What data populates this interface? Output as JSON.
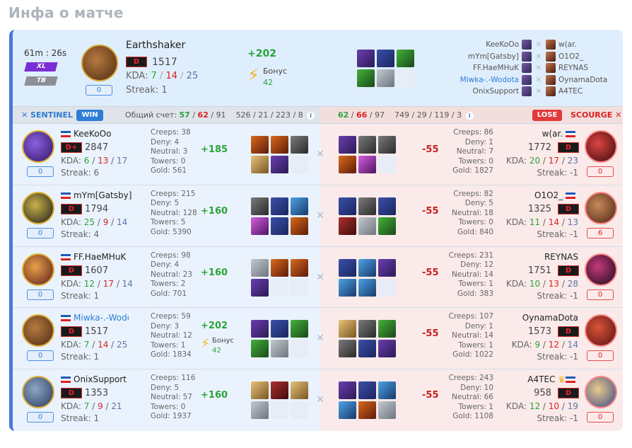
{
  "page_title": "Инфа о матче",
  "summary": {
    "duration": "61m : 26s",
    "mode_badge": "XL",
    "type_badge": "TB",
    "hero_name": "Earthshaker",
    "rank": "D",
    "mmr": "1517",
    "kda_label": "KDA:",
    "kills": "7",
    "deaths": "14",
    "assists": "25",
    "streak": "Streak: 1",
    "pill": "0",
    "delta": "+202",
    "bonus_label": "Бонус",
    "bonus_value": "42"
  },
  "roster": [
    {
      "left": "KeeKoOo",
      "right": "w(ar."
    },
    {
      "left": "mYm[Gatsby]",
      "right": "O1O2_"
    },
    {
      "left": "FF.HaeMHuK",
      "right": "REYNAS"
    },
    {
      "left": "Miwka-.-Wodota",
      "right": "OynamaDota"
    },
    {
      "left": "OnixSupport",
      "right": "A4TEC"
    }
  ],
  "teambar": {
    "sentinel": "SENTINEL",
    "win": "WIN",
    "score_label": "Общий счет:",
    "left_score": {
      "k": "57",
      "d": "62",
      "a": "91"
    },
    "left_extra": "526 / 21 / 223 / 8",
    "right_score": {
      "k": "62",
      "d": "66",
      "a": "97"
    },
    "right_extra": "749 / 29 / 119 / 3",
    "lose": "LOSE",
    "scourge": "SCOURGE"
  },
  "players": [
    {
      "left": {
        "name": "KeeKoOo",
        "rank": "D+",
        "mmr": "2847",
        "k": "6",
        "d": "13",
        "a": "17",
        "streak": "Streak: 6",
        "pill": "0",
        "creeps": "Creeps: 38",
        "deny": "Deny: 4",
        "neutral": "Neutral: 3",
        "towers": "Towers: 0",
        "gold": "Gold: 561",
        "delta": "+185"
      },
      "right": {
        "name": "w(ar.",
        "rank": "D",
        "mmr": "1772",
        "k": "20",
        "d": "17",
        "a": "23",
        "streak": "Streak: -1",
        "pill": "0",
        "creeps": "Creeps: 86",
        "deny": "Deny: 1",
        "neutral": "Neutral: 7",
        "towers": "Towers: 0",
        "gold": "Gold: 1827",
        "delta": "-55"
      }
    },
    {
      "left": {
        "name": "mYm[Gatsby]",
        "rank": "D",
        "mmr": "1794",
        "k": "25",
        "d": "9",
        "a": "14",
        "streak": "Streak: 4",
        "pill": "0",
        "creeps": "Creeps: 215",
        "deny": "Deny: 5",
        "neutral": "Neutral: 128",
        "towers": "Towers: 5",
        "gold": "Gold: 5390",
        "delta": "+160"
      },
      "right": {
        "name": "O1O2_",
        "rank": "D",
        "mmr": "1325",
        "k": "11",
        "d": "14",
        "a": "13",
        "streak": "Streak: -1",
        "pill": "6",
        "creeps": "Creeps: 82",
        "deny": "Deny: 5",
        "neutral": "Neutral: 18",
        "towers": "Towers: 0",
        "gold": "Gold: 840",
        "delta": "-55"
      }
    },
    {
      "left": {
        "name": "FF.HaeMHuK",
        "rank": "D",
        "mmr": "1607",
        "k": "12",
        "d": "17",
        "a": "14",
        "streak": "Streak: 1",
        "pill": "0",
        "creeps": "Creeps: 98",
        "deny": "Deny: 4",
        "neutral": "Neutral: 23",
        "towers": "Towers: 2",
        "gold": "Gold: 701",
        "delta": "+160"
      },
      "right": {
        "name": "REYNAS",
        "rank": "D",
        "mmr": "1751",
        "k": "10",
        "d": "13",
        "a": "28",
        "streak": "Streak: -1",
        "pill": "0",
        "creeps": "Creeps: 231",
        "deny": "Deny: 12",
        "neutral": "Neutral: 14",
        "towers": "Towers: 1",
        "gold": "Gold: 383",
        "delta": "-55"
      }
    },
    {
      "left": {
        "name": "Miwka-.-Wodota",
        "rank": "D",
        "mmr": "1517",
        "k": "7",
        "d": "14",
        "a": "25",
        "streak": "Streak: 1",
        "pill": "0",
        "creeps": "Creeps: 59",
        "deny": "Deny: 3",
        "neutral": "Neutral: 12",
        "towers": "Towers: 1",
        "gold": "Gold: 1834",
        "delta": "+202",
        "bonus_label": "Бонус",
        "bonus_value": "42"
      },
      "right": {
        "name": "OynamaDota",
        "rank": "D",
        "mmr": "1573",
        "k": "9",
        "d": "12",
        "a": "14",
        "streak": "Streak: -1",
        "pill": "0",
        "creeps": "Creeps: 107",
        "deny": "Deny: 1",
        "neutral": "Neutral: 14",
        "towers": "Towers: 1",
        "gold": "Gold: 1022",
        "delta": "-55"
      }
    },
    {
      "left": {
        "name": "OnixSupport",
        "rank": "D",
        "mmr": "1353",
        "k": "7",
        "d": "9",
        "a": "21",
        "streak": "Streak: 1",
        "pill": "0",
        "creeps": "Creeps: 116",
        "deny": "Deny: 5",
        "neutral": "Neutral: 57",
        "towers": "Towers: 0",
        "gold": "Gold: 1937",
        "delta": "+160"
      },
      "right": {
        "name": "A4TEC",
        "rank": "D",
        "mmr": "958",
        "k": "12",
        "d": "10",
        "a": "19",
        "streak": "Streak: -1",
        "pill": "0",
        "creeps": "Creeps: 243",
        "deny": "Deny: 10",
        "neutral": "Neutral: 66",
        "towers": "Towers: 1",
        "gold": "Gold: 1108",
        "delta": "-55"
      }
    }
  ],
  "colors": {
    "win_blue": "#2d7dd6",
    "lose_red": "#e03a3a",
    "positive": "#2aa33a",
    "negative": "#c62020",
    "accent_border": "#4a78d8"
  },
  "icons": {
    "cross": "crossed-swords-icon",
    "bolt": "lightning-bolt-icon",
    "info": "info-icon"
  }
}
